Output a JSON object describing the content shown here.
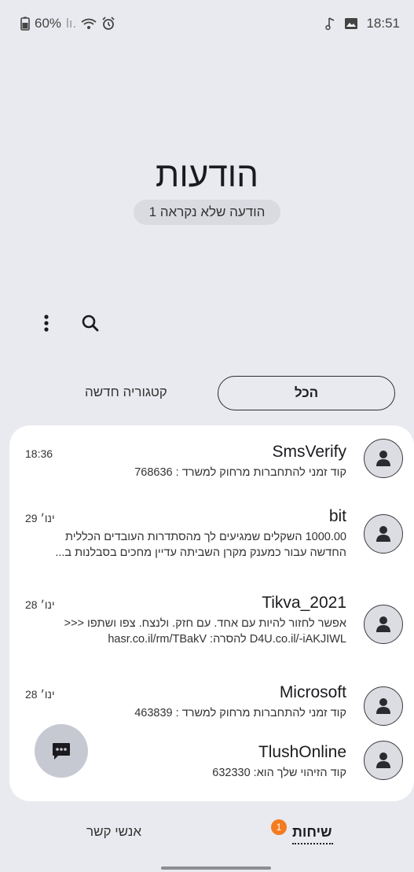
{
  "status_bar": {
    "battery": "60%",
    "signal": "lı.",
    "time": "18:51"
  },
  "header": {
    "title": "הודעות",
    "unread": "1 הודעה שלא נקראה"
  },
  "filters": {
    "all": "הכל",
    "new_category": "קטגוריה חדשה"
  },
  "conversations": [
    {
      "sender": "SmsVerify",
      "time": "18:36",
      "lines": [
        "קוד זמני להתחברות מרחוק למשרד : 768636"
      ]
    },
    {
      "sender": "bit",
      "time": "29 ינו׳",
      "lines": [
        "1000.00 השקלים שמגיעים לך מהסתדרות העובדים הכללית",
        "החדשה עבור כמענק מקרן השביתה עדיין מחכים בסבלנות ב..."
      ]
    },
    {
      "sender": "Tikva_2021",
      "time": "28 ינו׳",
      "lines": [
        "אפשר לחזור להיות עם אחד. עם חזק. ולנצח.  צפו ושתפו <<<",
        "hasr.co.il/rm/TBakV :להסרה  D4U.co.il/-iAKJIWL"
      ]
    },
    {
      "sender": "Microsoft",
      "time": "28 ינו׳",
      "lines": [
        "קוד זמני להתחברות מרחוק למשרד : 463839"
      ]
    },
    {
      "sender": "TlushOnline",
      "time": "",
      "lines": [
        "קוד הזיהוי שלך הוא: 632330"
      ]
    }
  ],
  "bottom_nav": {
    "conversations": "שיחות",
    "badge": "1",
    "contacts": "אנשי קשר"
  },
  "colors": {
    "background": "#e9eaef",
    "card": "#ffffff",
    "badge": "#f47b20"
  }
}
